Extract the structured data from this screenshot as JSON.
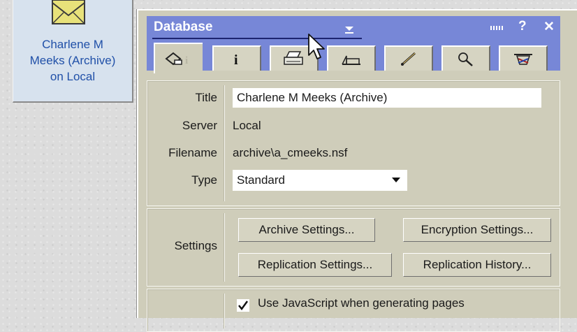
{
  "desktop_icon": {
    "label_lines": [
      "Charlene M",
      "Meeks (Archive)",
      "on Local"
    ]
  },
  "panel": {
    "title": "Database",
    "help_label": "?",
    "close_label": "✕",
    "tabs": [
      {
        "icon": "database-info-icon"
      },
      {
        "icon": "info-icon"
      },
      {
        "icon": "printer-icon"
      },
      {
        "icon": "design-icon"
      },
      {
        "icon": "launch-icon"
      },
      {
        "icon": "full-text-search-icon"
      },
      {
        "icon": "advanced-icon"
      }
    ]
  },
  "info": {
    "title_label": "Title",
    "title_value": "Charlene M Meeks (Archive)",
    "server_label": "Server",
    "server_value": "Local",
    "filename_label": "Filename",
    "filename_value": "archive\\a_cmeeks.nsf",
    "type_label": "Type",
    "type_value": "Standard"
  },
  "settings": {
    "label": "Settings",
    "archive_button": "Archive Settings...",
    "encryption_button": "Encryption Settings...",
    "replication_button": "Replication Settings...",
    "history_button": "Replication History..."
  },
  "options": {
    "javascript_label": "Use JavaScript when generating pages",
    "javascript_checked": true
  },
  "colors": {
    "titlebar": "#7787d7",
    "panel_bg": "#cfcdba",
    "icon_label": "#2050a8"
  }
}
